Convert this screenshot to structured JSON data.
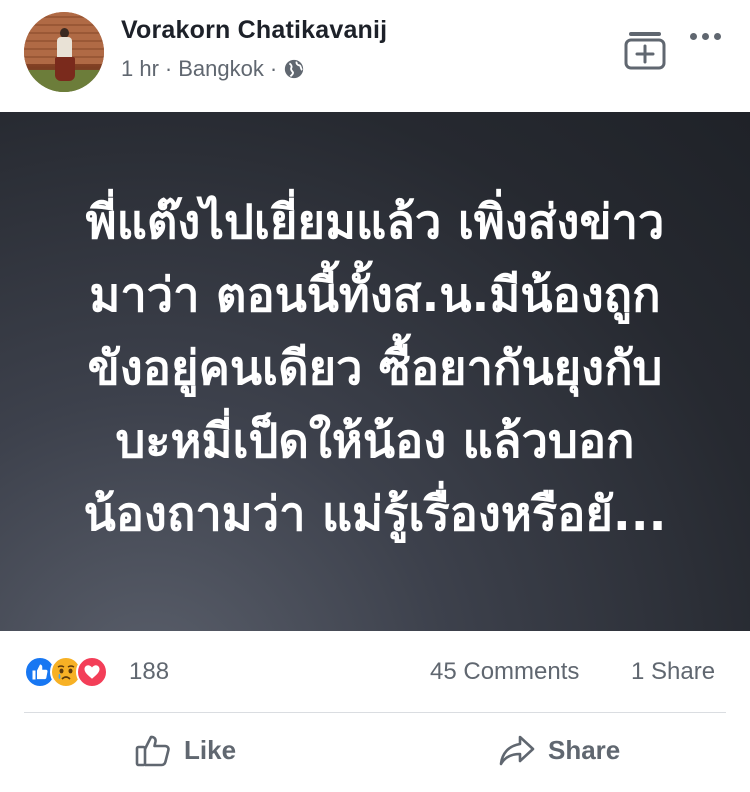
{
  "header": {
    "author_name": "Vorakorn Chatikavanij",
    "time": "1 hr",
    "separator": "·",
    "location": "Bangkok",
    "separator2": "·",
    "privacy_icon": "globe-icon",
    "save_icon": "collection-add-icon",
    "more_icon": "more-horizontal-icon"
  },
  "post": {
    "text": "พี่แต๊งไปเยี่ยมแล้ว เพิ่งส่งข่าว\nมาว่า ตอนนี้ทั้งส.น.มีน้องถูก\nขังอยู่คนเดียว ซื้อยากันยุงกับ\nบะหมี่เป็ดให้น้อง แล้วบอก\nน้องถามว่า แม่รู้เรื่องหรือยั...",
    "background_color": "#2a2d34"
  },
  "stats": {
    "reaction_icons": [
      "like-icon",
      "sad-icon",
      "love-icon"
    ],
    "reaction_count": "188",
    "comments": "45 Comments",
    "shares": "1 Share"
  },
  "actions": {
    "like_label": "Like",
    "share_label": "Share"
  },
  "colors": {
    "like_blue": "#1877f2",
    "sad_yellow": "#f7b125",
    "love_red": "#f33e58",
    "secondary_text": "#606770"
  }
}
